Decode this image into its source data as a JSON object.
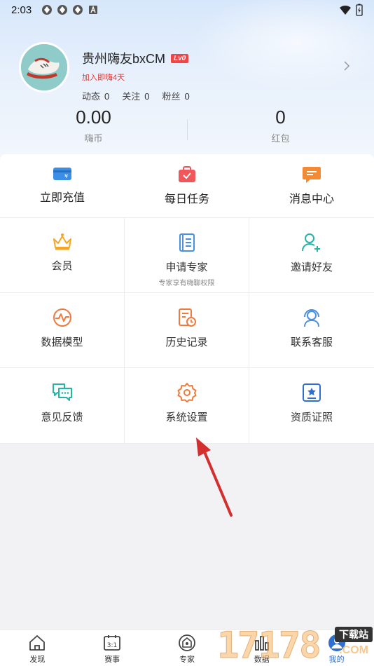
{
  "status_bar": {
    "time": "2:03"
  },
  "profile": {
    "username": "贵州嗨友bxCM",
    "level": "Lv0",
    "join_text": "加入即嗨4天",
    "stats": [
      {
        "label": "动态",
        "value": "0"
      },
      {
        "label": "关注",
        "value": "0"
      },
      {
        "label": "粉丝",
        "value": "0"
      }
    ]
  },
  "wallet": {
    "coins": {
      "value": "0.00",
      "label": "嗨币"
    },
    "red_packet": {
      "value": "0",
      "label": "红包"
    }
  },
  "quick_actions": [
    {
      "label": "立即充值",
      "icon": "wallet-card-icon",
      "color": "#3a8ee6"
    },
    {
      "label": "每日任务",
      "icon": "task-bag-icon",
      "color": "#f0575a"
    },
    {
      "label": "消息中心",
      "icon": "message-icon",
      "color": "#f58a34"
    }
  ],
  "menu": [
    {
      "label": "会员",
      "sub": "",
      "icon": "crown-icon",
      "color": "#f5a623"
    },
    {
      "label": "申请专家",
      "sub": "专家享有嗨聊权限",
      "icon": "document-icon",
      "color": "#4a90e2"
    },
    {
      "label": "邀请好友",
      "sub": "",
      "icon": "add-user-icon",
      "color": "#26b5a5"
    },
    {
      "label": "数据模型",
      "sub": "",
      "icon": "pulse-icon",
      "color": "#f07a3c"
    },
    {
      "label": "历史记录",
      "sub": "",
      "icon": "history-icon",
      "color": "#f07a3c"
    },
    {
      "label": "联系客服",
      "sub": "",
      "icon": "support-icon",
      "color": "#4a90e2"
    },
    {
      "label": "意见反馈",
      "sub": "",
      "icon": "feedback-icon",
      "color": "#26b5a5"
    },
    {
      "label": "系统设置",
      "sub": "",
      "icon": "gear-icon",
      "color": "#f07a3c"
    },
    {
      "label": "资质证照",
      "sub": "",
      "icon": "certificate-icon",
      "color": "#2e6fcf"
    }
  ],
  "tab_bar": [
    {
      "label": "发现",
      "icon": "home-icon"
    },
    {
      "label": "赛事",
      "icon": "scoreboard-icon",
      "glyph": "3:1"
    },
    {
      "label": "专家",
      "icon": "expert-icon"
    },
    {
      "label": "数据",
      "icon": "data-icon"
    },
    {
      "label": "我的",
      "icon": "profile-icon"
    }
  ],
  "watermark": {
    "digits": "17178",
    "tag": "下载站",
    "suffix": ".COM"
  }
}
